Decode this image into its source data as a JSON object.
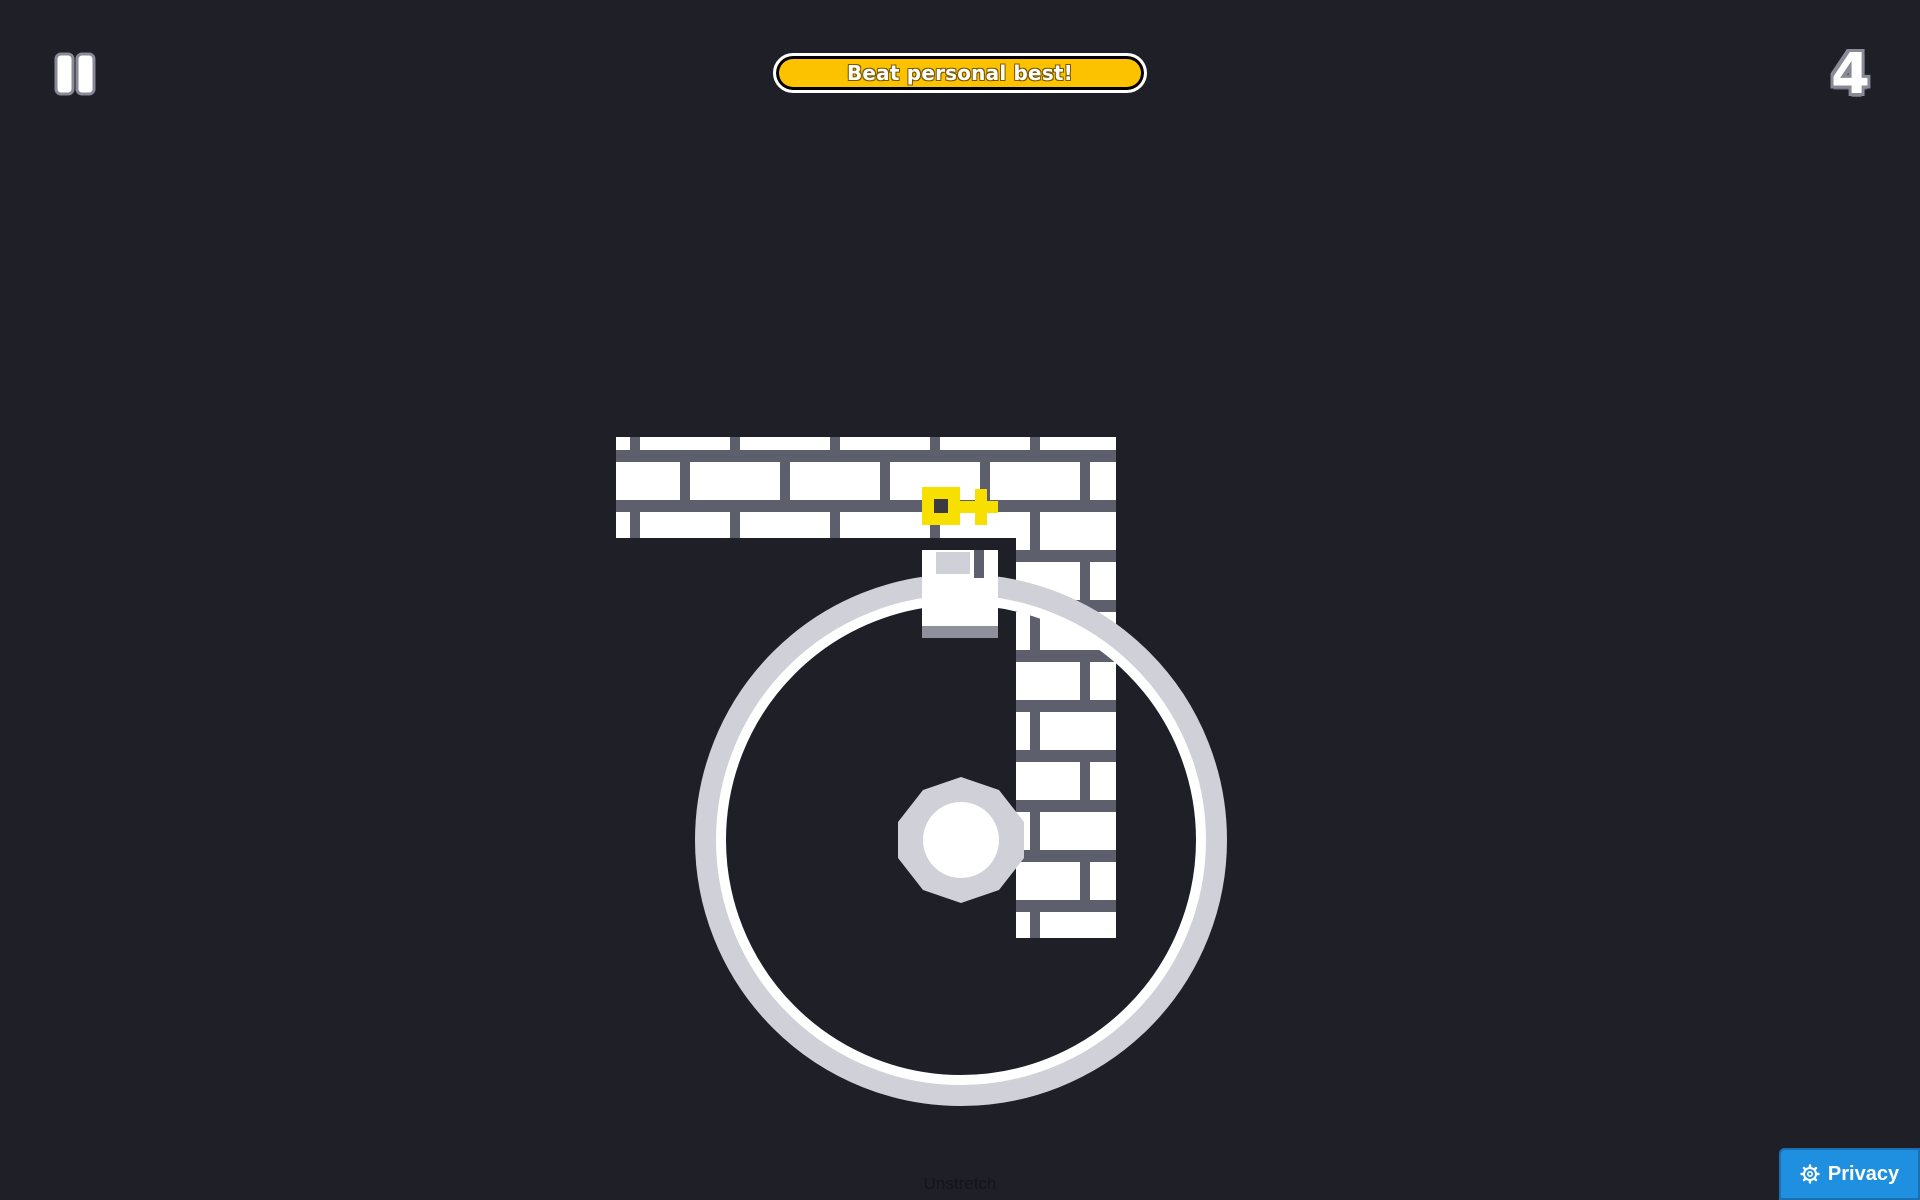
{
  "hud": {
    "pause_icon": "pause-icon",
    "banner_text": "Beat personal best!",
    "score": "4"
  },
  "colors": {
    "background": "#1e1f27",
    "banner": "#fcc200",
    "brick": "#ffffff",
    "mortar": "#5d5f6d",
    "key": "#f7df00",
    "ring": "#cfd0d8",
    "privacy": "#1f8fe0"
  },
  "footer": {
    "unstretch_label": "Unstretch",
    "privacy_label": "Privacy",
    "privacy_icon": "gear-icon"
  }
}
